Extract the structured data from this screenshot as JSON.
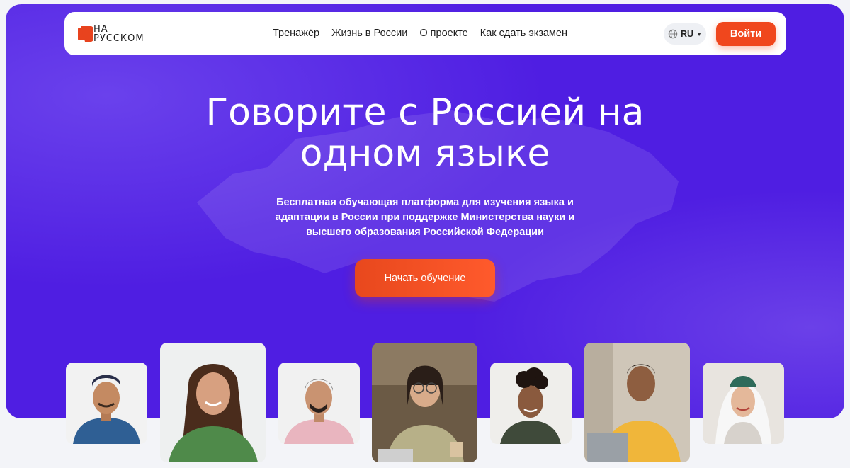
{
  "logo": {
    "line1": "НА",
    "line2": "РУССКОМ"
  },
  "nav": {
    "links": [
      "Тренажёр",
      "Жизнь в России",
      "О проекте",
      "Как сдать экзамен"
    ],
    "language": "RU",
    "login_label": "Войти"
  },
  "hero": {
    "headline_line1": "Говорите с Россией на",
    "headline_line2": "одном языке",
    "subtitle_line1": "Бесплатная обучающая платформа для изучения языка и",
    "subtitle_line2": "адаптации в России при поддержке Министерства науки и",
    "subtitle_line3": "высшего образования Российской Федерации",
    "cta_label": "Начать обучение"
  },
  "colors": {
    "hero_bg": "#4f1ee2",
    "accent": "#f0471d",
    "nav_bg": "#ffffff",
    "page_bg": "#f3f4f8"
  },
  "photos": [
    "man-in-skullcap-denim-jacket",
    "woman-long-hair-green-sweater",
    "man-pink-shirt",
    "woman-glasses-laptop-cafe",
    "woman-curly-hair",
    "man-yellow-shirt-laptop",
    "woman-headdress"
  ]
}
